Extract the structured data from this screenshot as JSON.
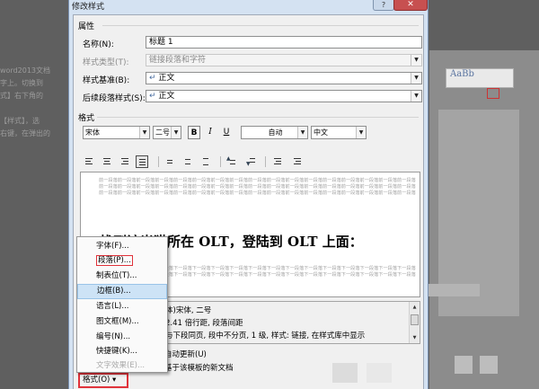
{
  "background": {
    "left_lines": [
      "word2013文档",
      "字上。切换到",
      "式】右下角的",
      "【样式】，选",
      "右键，在弹出的"
    ],
    "style_card_text": "AaBb"
  },
  "dialog": {
    "title": "修改样式",
    "help_label": "?",
    "close_label": "✕",
    "properties_label": "属性",
    "name_label": "名称(N):",
    "name_value": "标题 1",
    "type_label": "样式类型(T):",
    "type_value": "链接段落和字符",
    "based_label": "样式基准(B):",
    "based_value": "正文",
    "next_label": "后续段落样式(S):",
    "next_value": "正文",
    "para_mark": "↵",
    "format_label": "格式",
    "font_value": "宋体",
    "size_value": "二号",
    "bold_label": "B",
    "italic_label": "I",
    "underline_label": "U",
    "color_value": "自动",
    "lang_value": "中文",
    "preview_prev_line": "前一段落前一段落前一段落前一段落前一段落前一段落前一段落前一段落前一段落前一段落前一段落前一段落前一段落前一段落前一段落前一段落前一段落",
    "preview_text": "找到该光猫所在 OLT，登陆到 OLT 上面：",
    "preview_next_line": "下一段落下一段落下一段落下一段落下一段落下一段落下一段落下一段落下一段落下一段落下一段落下一段落下一段落下一段落下一段落下一段落下一段落",
    "desc_lines": [
      "体)宋体, 二号",
      "2.41 倍行距, 段落间距",
      "与下段同页, 段中不分页, 1 级, 样式: 链接, 在样式库中显示"
    ],
    "auto_update_label": "自动更新(U)",
    "new_docs_label": "基于该模板的新文档",
    "format_button_label": "格式(O) ▾"
  },
  "menu": {
    "items": [
      {
        "label": "字体(F)..."
      },
      {
        "label": "段落(P)..."
      },
      {
        "label": "制表位(T)..."
      },
      {
        "label": "边框(B)..."
      },
      {
        "label": "语言(L)..."
      },
      {
        "label": "图文框(M)..."
      },
      {
        "label": "编号(N)..."
      },
      {
        "label": "快捷键(K)..."
      },
      {
        "label": "文字效果(E)..."
      }
    ]
  },
  "colors": {
    "accent_red": "#e0323a",
    "dialog_frame": "#d4e2f2",
    "menu_highlight": "#cde3f6"
  }
}
